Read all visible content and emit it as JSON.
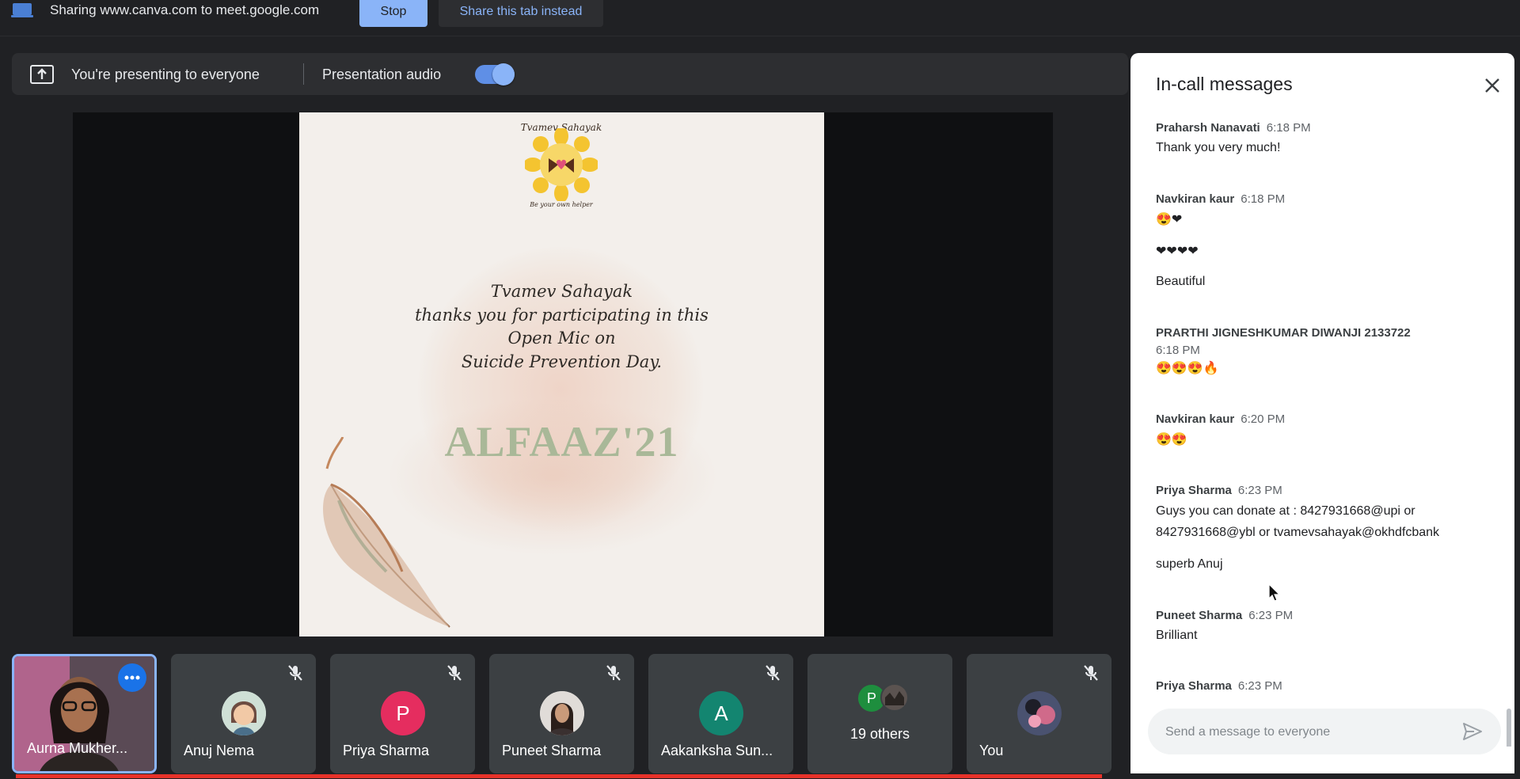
{
  "share_bar": {
    "text": "Sharing www.canva.com to meet.google.com",
    "stop_label": "Stop",
    "share_tab_label": "Share this tab instead"
  },
  "present_bar": {
    "text": "You're presenting to everyone",
    "audio_label": "Presentation audio",
    "audio_on": true
  },
  "slide": {
    "logo_top": "Tvamev Sahayak",
    "logo_bottom": "Be your own helper",
    "thanks_lines": [
      "Tvamev Sahayak",
      "thanks you for participating in this",
      "Open Mic on",
      "Suicide Prevention Day."
    ],
    "title": "ALFAAZ'21"
  },
  "participants": [
    {
      "name": "Aurna Mukher...",
      "icon": "video-feed"
    },
    {
      "name": "Anuj Nema",
      "icon": "avatar-cartoon",
      "muted": true
    },
    {
      "name": "Priya Sharma",
      "initial": "P",
      "color": "#e52d5f",
      "muted": true
    },
    {
      "name": "Puneet Sharma",
      "icon": "avatar-photo",
      "muted": true
    },
    {
      "name": "Aakanksha Sun...",
      "initial": "A",
      "color": "#138570",
      "muted": true
    },
    {
      "label": "19 others",
      "initial": "P",
      "color": "#1e8e3e"
    },
    {
      "name": "You",
      "icon": "avatar-photo",
      "muted": true
    }
  ],
  "chat": {
    "title": "In-call messages",
    "messages": [
      {
        "sender": "Praharsh Nanavati",
        "time": "6:18 PM",
        "lines": [
          "Thank you very much!"
        ]
      },
      {
        "sender": "Navkiran kaur",
        "time": "6:18 PM",
        "lines": [
          "😍❤",
          "❤❤❤❤",
          "Beautiful"
        ]
      },
      {
        "sender": "PRARTHI JIGNESHKUMAR DIWANJI 2133722",
        "time": "6:18 PM",
        "lines": [
          "😍😍😍🔥"
        ]
      },
      {
        "sender": "Navkiran kaur",
        "time": "6:20 PM",
        "lines": [
          "😍😍"
        ]
      },
      {
        "sender": "Priya Sharma",
        "time": "6:23 PM",
        "lines": [
          "Guys you can donate at : 8427931668@upi or",
          "8427931668@ybl or tvamevsahayak@okhdfcbank",
          "superb Anuj"
        ]
      },
      {
        "sender": "Puneet Sharma",
        "time": "6:23 PM",
        "lines": [
          "Brilliant"
        ]
      },
      {
        "sender": "Priya Sharma",
        "time": "6:23 PM",
        "lines": []
      }
    ],
    "input_placeholder": "Send a message to everyone"
  },
  "colors": {
    "accent": "#8ab4f8",
    "background": "#202124",
    "tile": "#3c4043",
    "progress": "#e8322a"
  }
}
